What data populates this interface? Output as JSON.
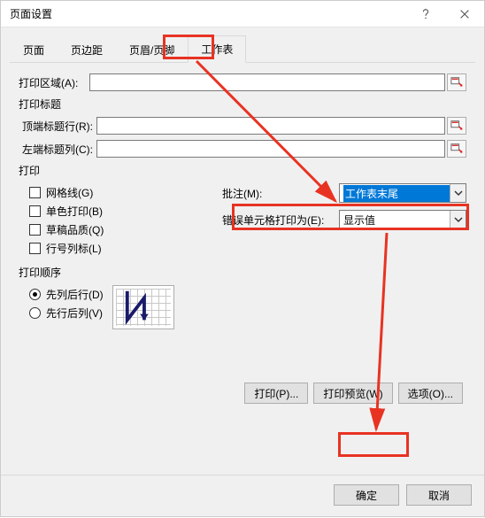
{
  "titlebar": {
    "title": "页面设置"
  },
  "tabs": [
    {
      "label": "页面"
    },
    {
      "label": "页边距"
    },
    {
      "label": "页眉/页脚"
    },
    {
      "label": "工作表"
    }
  ],
  "print_area": {
    "label": "打印区域(A):",
    "value": ""
  },
  "print_titles": {
    "section_label": "打印标题",
    "rows": {
      "label": "顶端标题行(R):",
      "value": ""
    },
    "cols": {
      "label": "左端标题列(C):",
      "value": ""
    }
  },
  "print_section": {
    "label": "打印",
    "gridlines": "网格线(G)",
    "black_white": "单色打印(B)",
    "draft": "草稿品质(Q)",
    "row_col_headers": "行号列标(L)",
    "comments": {
      "label": "批注(M):",
      "value": "工作表末尾"
    },
    "errors": {
      "label": "错误单元格打印为(E):",
      "value": "显示值"
    }
  },
  "order_section": {
    "label": "打印顺序",
    "down_then_over": "先列后行(D)",
    "over_then_down": "先行后列(V)"
  },
  "buttons": {
    "print": "打印(P)...",
    "preview": "打印预览(W)",
    "options": "选项(O)...",
    "ok": "确定",
    "cancel": "取消"
  }
}
